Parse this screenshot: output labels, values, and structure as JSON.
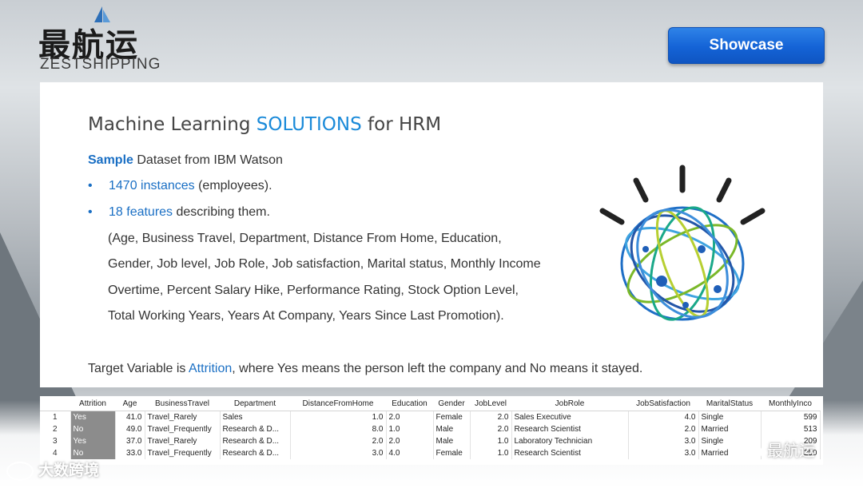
{
  "logo": {
    "cn": "最航运",
    "en": "ZESTSHIPPING"
  },
  "header": {
    "showcase_label": "Showcase"
  },
  "slide": {
    "title_pre": "Machine Learning ",
    "title_highlight": "SOLUTIONS",
    "title_post": " for HRM",
    "sample_bold": "Sample",
    "sample_rest": " Dataset from IBM Watson",
    "bullets": [
      {
        "blue": "1470 instances",
        "rest": " (employees)."
      },
      {
        "blue": "18 features",
        "rest": " describing them."
      }
    ],
    "features_lines": [
      "(Age, Business Travel, Department, Distance From Home, Education,",
      "Gender, Job level, Job Role, Job satisfaction, Marital status, Monthly Income",
      "Overtime, Percent Salary Hike, Performance Rating, Stock Option Level,",
      "Total Working Years, Years At Company, Years Since Last Promotion)."
    ],
    "target_pre": "Target Variable is ",
    "target_blue": "Attrition",
    "target_post": ", where Yes means the person left the company and No means it stayed."
  },
  "table": {
    "columns": [
      "",
      "Attrition",
      "Age",
      "BusinessTravel",
      "Department",
      "DistanceFromHome",
      "Education",
      "Gender",
      "JobLevel",
      "JobRole",
      "JobSatisfaction",
      "MaritalStatus",
      "MonthlyInco"
    ],
    "rows": [
      [
        "1",
        "Yes",
        "41.0",
        "Travel_Rarely",
        "Sales",
        "1.0",
        "2.0",
        "Female",
        "2.0",
        "Sales Executive",
        "4.0",
        "Single",
        "599"
      ],
      [
        "2",
        "No",
        "49.0",
        "Travel_Frequently",
        "Research & D...",
        "8.0",
        "1.0",
        "Male",
        "2.0",
        "Research Scientist",
        "2.0",
        "Married",
        "513"
      ],
      [
        "3",
        "Yes",
        "37.0",
        "Travel_Rarely",
        "Research & D...",
        "2.0",
        "2.0",
        "Male",
        "1.0",
        "Laboratory Technician",
        "3.0",
        "Single",
        "209"
      ],
      [
        "4",
        "No",
        "33.0",
        "Travel_Frequently",
        "Research & D...",
        "3.0",
        "4.0",
        "Female",
        "1.0",
        "Research Scientist",
        "3.0",
        "Married",
        "290"
      ]
    ]
  },
  "watermarks": {
    "left": "大数跨境",
    "right": "最航运"
  },
  "colors": {
    "accent": "#1a8ad9",
    "button": "#1463d6"
  }
}
